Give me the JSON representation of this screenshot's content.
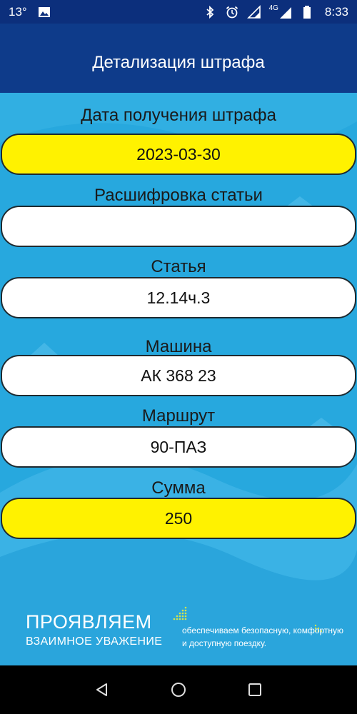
{
  "status_bar": {
    "temperature": "13°",
    "network": "4G",
    "time": "8:33"
  },
  "app_bar": {
    "title": "Детализация штрафа"
  },
  "fields": [
    {
      "label": "Дата получения штрафа",
      "value": "2023-03-30",
      "highlight": true
    },
    {
      "label": "Расшифровка статьи",
      "value": "",
      "highlight": false
    },
    {
      "label": "Статья",
      "value": "12.14ч.3",
      "highlight": false
    },
    {
      "label": "Машина",
      "value": "АК 368 23",
      "highlight": false
    },
    {
      "label": "Маршрут",
      "value": "90-ПАЗ",
      "highlight": false
    },
    {
      "label": "Сумма",
      "value": "250",
      "highlight": true
    }
  ],
  "footer": {
    "brand_main": "ПРОЯВЛЯЕМ",
    "brand_sub": "ВЗАИМНОЕ УВАЖЕНИЕ",
    "slogan": "обеспечиваем безопасную, комфортную и доступную поездку."
  },
  "colors": {
    "header": "#0e3b8a",
    "background": "#27a8de",
    "highlight": "#fff200"
  }
}
